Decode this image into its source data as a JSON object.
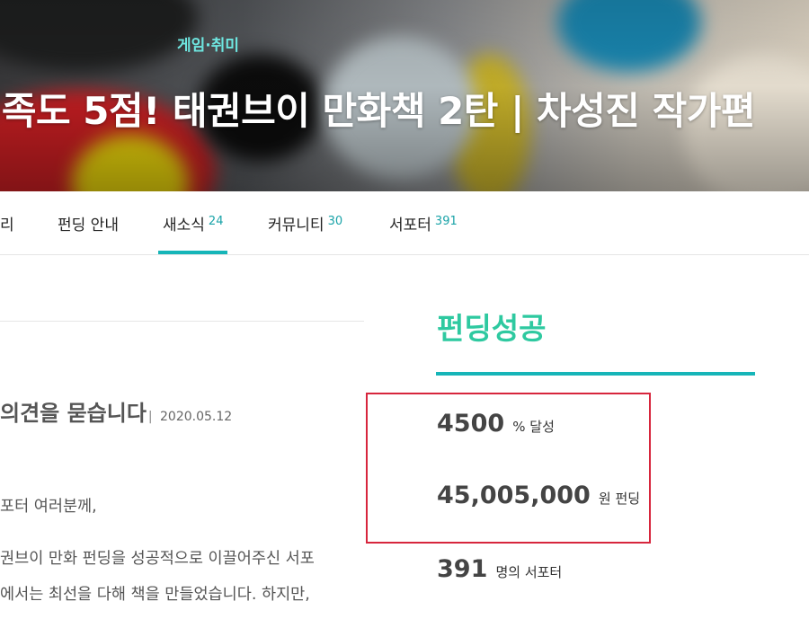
{
  "hero": {
    "category": "게임·취미",
    "title": "족도 5점! 태권브이 만화책 2탄 | 차성진 작가편"
  },
  "tabs": [
    {
      "label": "리",
      "count": ""
    },
    {
      "label": "펀딩 안내",
      "count": ""
    },
    {
      "label": "새소식",
      "count": "24"
    },
    {
      "label": "커뮤니티",
      "count": "30"
    },
    {
      "label": "서포터",
      "count": "391"
    }
  ],
  "post": {
    "title": "의견을 묻습니다",
    "separator": "|",
    "date": "2020.05.12",
    "lines": [
      "포터 여러분께,",
      "권브이 만화 펀딩을 성공적으로 이끌어주신 서포",
      "에서는 최선을 다해 책을 만들었습니다. 하지만,"
    ]
  },
  "funding": {
    "status": "펀딩성공",
    "percent_value": "4500",
    "percent_unit": "% 달성",
    "amount_value": "45,005,000",
    "amount_unit": "원 펀딩",
    "supporters_value": "391",
    "supporters_unit": "명의 서포터"
  },
  "colors": {
    "accent": "#16b5b8",
    "status_green": "#2ec9a0",
    "category": "#6ee6e0",
    "highlight_box": "#d7263d"
  }
}
